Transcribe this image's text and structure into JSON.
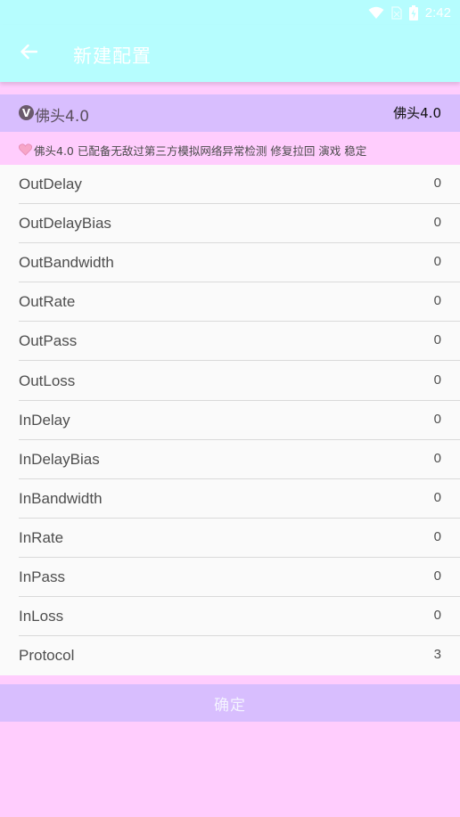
{
  "status_bar": {
    "time": "2:42",
    "icons": [
      "wifi-icon",
      "no-sim-icon",
      "battery-charging-icon"
    ]
  },
  "app_bar": {
    "back_icon": "arrow-left-icon",
    "title": "新建配置"
  },
  "header": {
    "badge": "V",
    "left_text": "佛头4.0",
    "right_text": "佛头4.0"
  },
  "notice": {
    "icon": "heart-icon",
    "text": "佛头4.0 已配备无敌过第三方模拟网络异常检测 修复拉回 演戏  稳定"
  },
  "settings": [
    {
      "label": "OutDelay",
      "value": "0"
    },
    {
      "label": "OutDelayBias",
      "value": "0"
    },
    {
      "label": "OutBandwidth",
      "value": "0"
    },
    {
      "label": "OutRate",
      "value": "0"
    },
    {
      "label": "OutPass",
      "value": "0"
    },
    {
      "label": "OutLoss",
      "value": "0"
    },
    {
      "label": "InDelay",
      "value": "0"
    },
    {
      "label": "InDelayBias",
      "value": "0"
    },
    {
      "label": "InBandwidth",
      "value": "0"
    },
    {
      "label": "InRate",
      "value": "0"
    },
    {
      "label": "InPass",
      "value": "0"
    },
    {
      "label": "InLoss",
      "value": "0"
    },
    {
      "label": "Protocol",
      "value": "3"
    }
  ],
  "confirm_label": "确定",
  "colors": {
    "app_bar": "#b6fdfe",
    "background": "#ffcdfd",
    "accent": "#d8befe",
    "list_bg": "#fafafa"
  }
}
